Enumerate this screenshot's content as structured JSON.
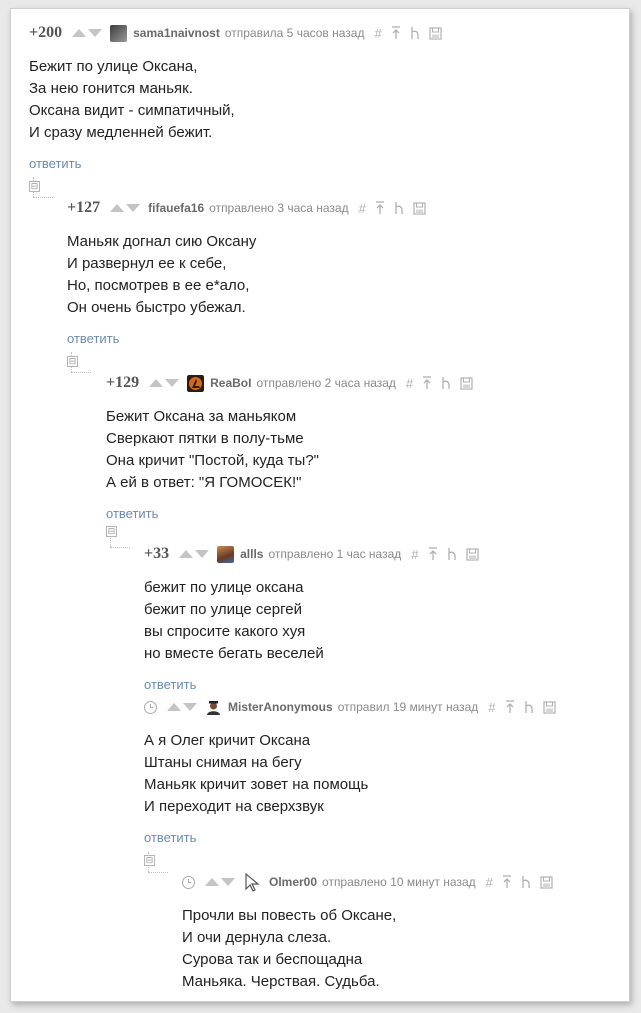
{
  "comments": [
    {
      "rating": "+200",
      "username": "sama1naivnost",
      "posted": "отправила 5 часов назад",
      "lines": [
        "Бежит по улице Оксана,",
        "За нею гонится маньяк.",
        "Оксана видит - симпатичный,",
        "И сразу медленней бежит."
      ],
      "reply": "ответить"
    },
    {
      "rating": "+127",
      "username": "fifauefa16",
      "posted": "отправлено 3 часа назад",
      "lines": [
        "Маньяк догнал сию Оксану",
        "И развернул ее к себе,",
        "Но, посмотрев в ее е*ало,",
        "Он очень быстро убежал."
      ],
      "reply": "ответить"
    },
    {
      "rating": "+129",
      "username": "ReaBoI",
      "posted": "отправлено 2 часа назад",
      "lines": [
        "Бежит Оксана за маньяком",
        "Сверкают пятки в полу-тьме",
        "Она кричит \"Постой, куда ты?\"",
        "А ей в ответ: \"Я ГОМОСЕК!\""
      ],
      "reply": "ответить"
    },
    {
      "rating": "+33",
      "username": "allls",
      "posted": "отправлено 1 час назад",
      "lines": [
        "бежит по улице оксана",
        "бежит по улице сергей",
        "вы спросите какого хуя",
        "но вместе бегать веселей"
      ],
      "reply": "ответить"
    },
    {
      "rating": "",
      "username": "MisterAnonymous",
      "posted": "отправил 19 минут назад",
      "lines": [
        "А я Олег кричит Оксана",
        "Штаны снимая на бегу",
        "Маньяк кричит зовет на помощь",
        "И переходит на сверхзвук"
      ],
      "reply": "ответить"
    },
    {
      "rating": "",
      "username": "Olmer00",
      "posted": "отправлено 10 минут назад",
      "lines": [
        "Прочли вы повесть об Оксане,",
        "И очи дернула слеза.",
        "Сурова так и беспощадна",
        "Маньяка. Черствая. Судьба."
      ],
      "reply": ""
    }
  ],
  "icons": {
    "hash": "#",
    "collapse": "⊟"
  },
  "colors": {
    "reply_link": "#6b8ab2",
    "meta_text": "#8a8a8a",
    "body_text": "#222222"
  }
}
